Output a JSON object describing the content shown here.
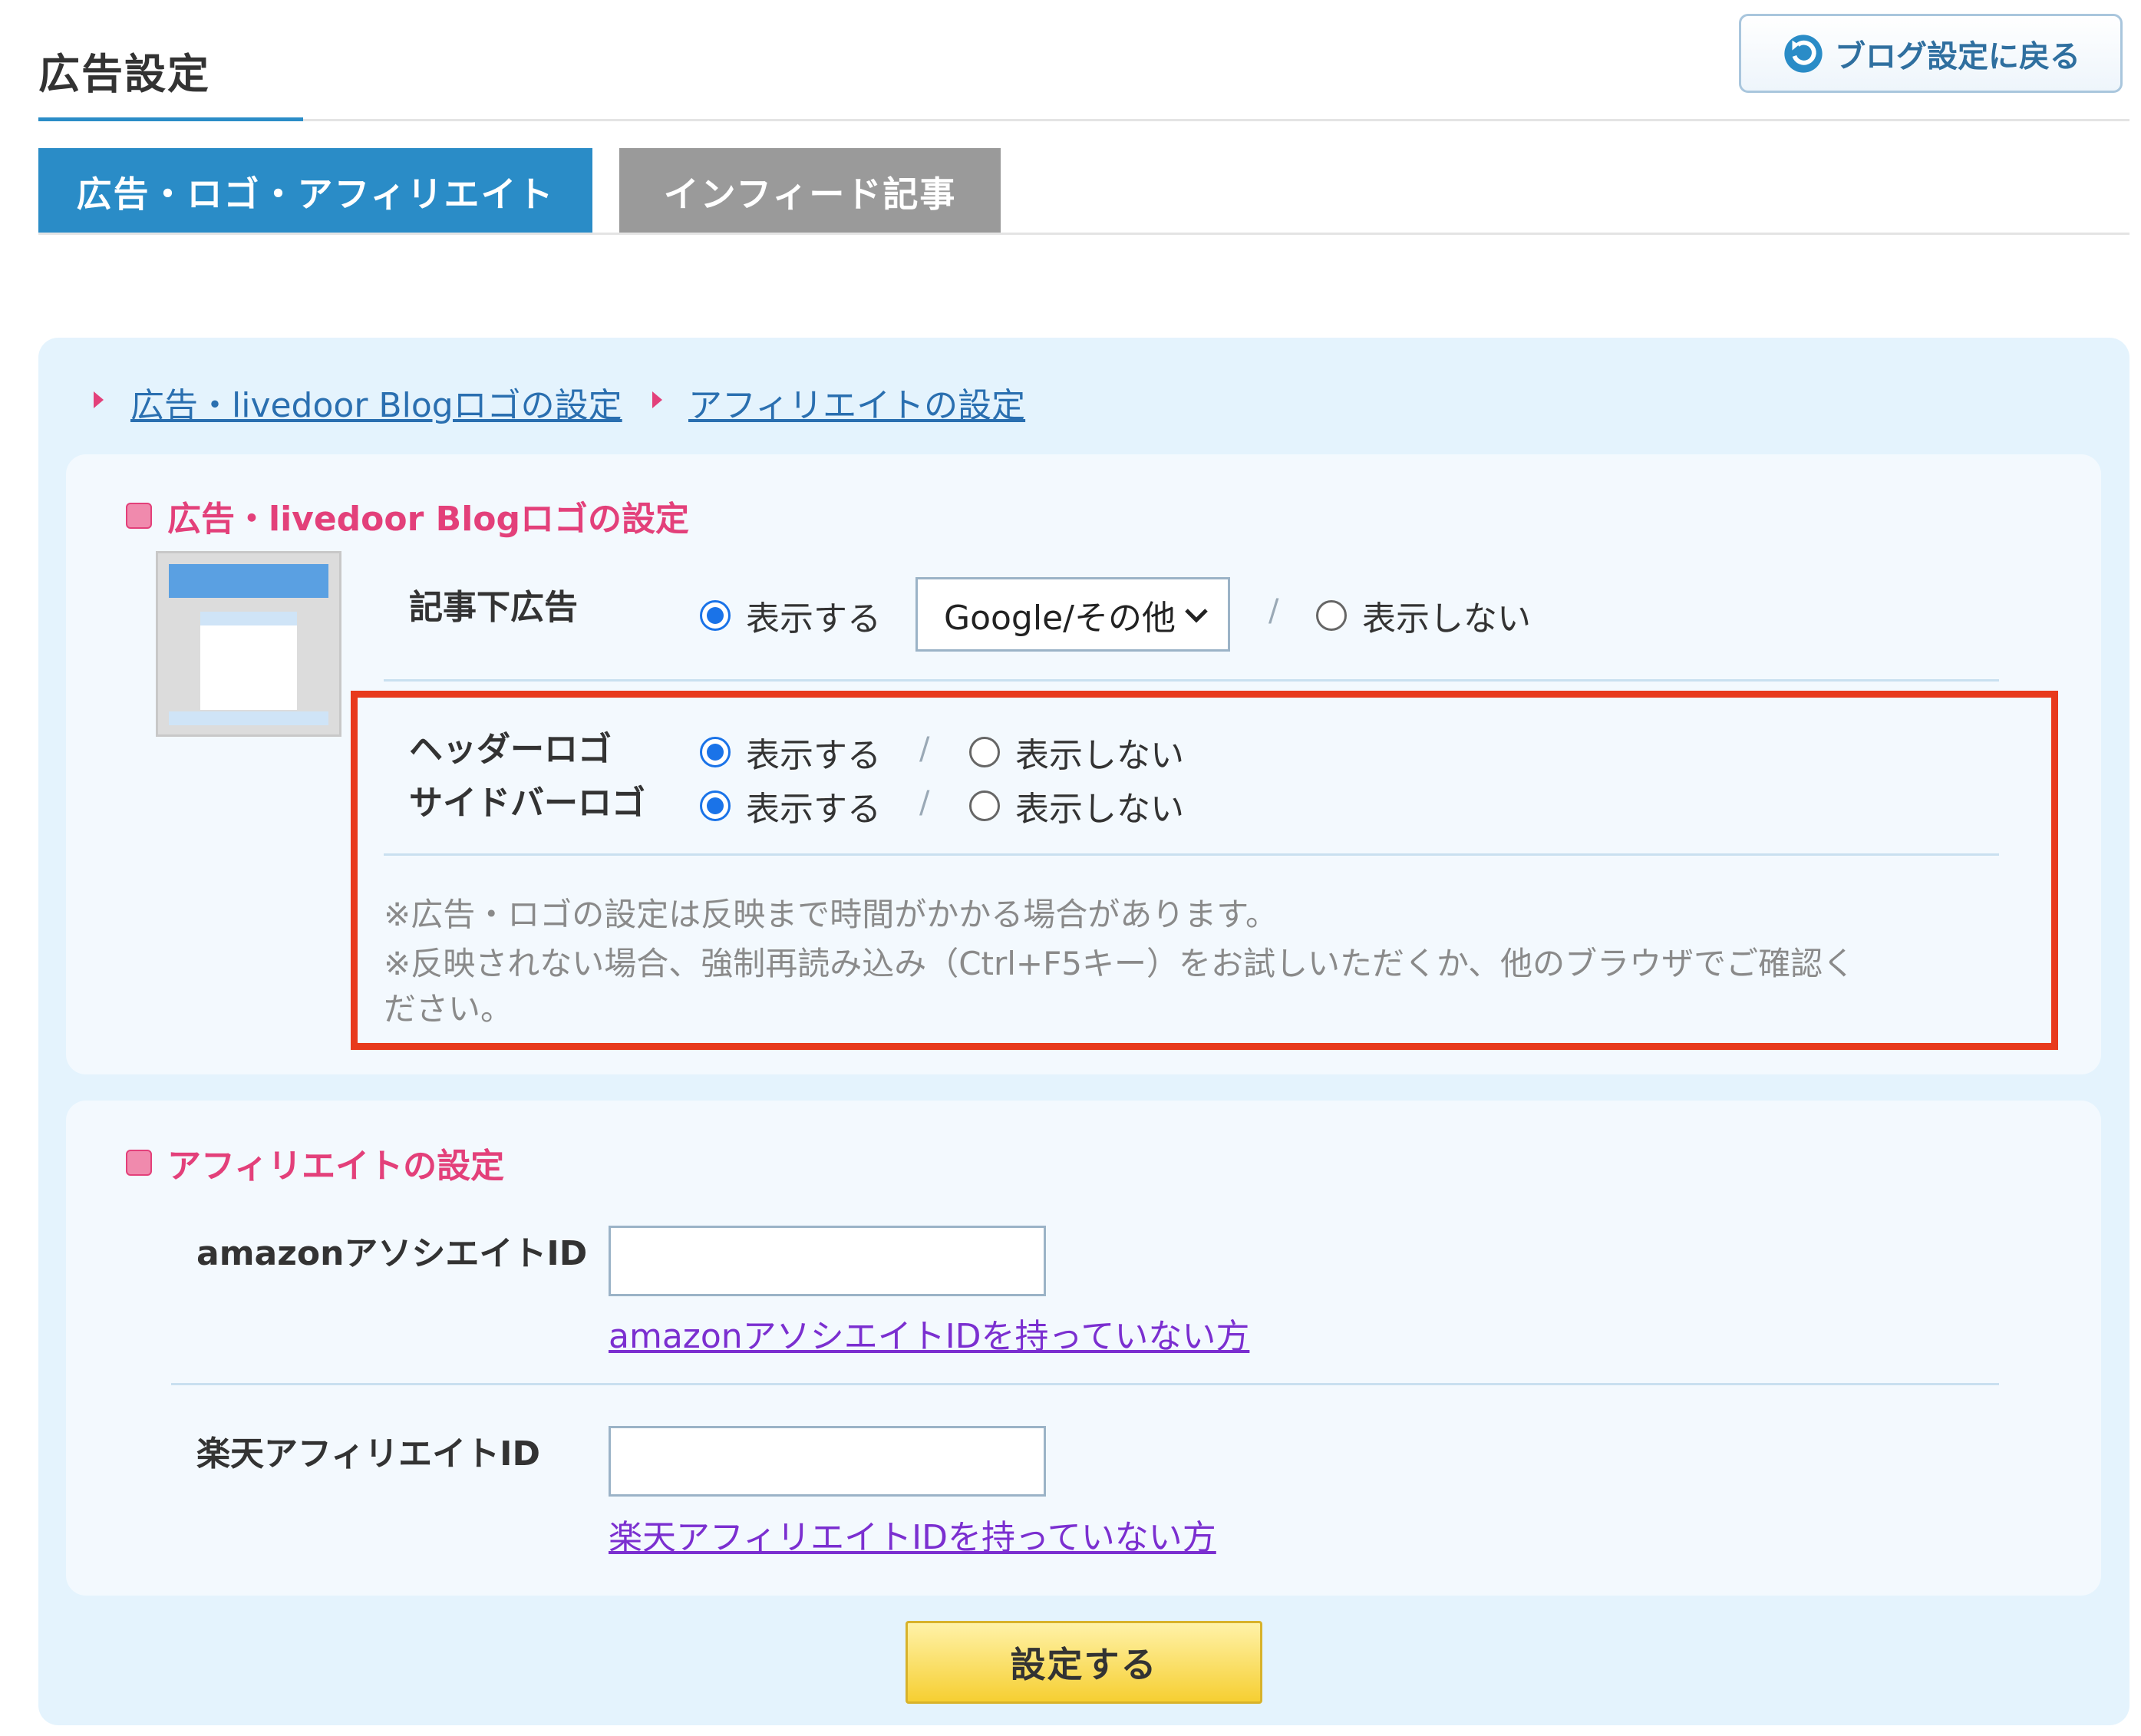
{
  "header": {
    "title": "広告設定",
    "back_button": "ブログ設定に戻る"
  },
  "tabs": [
    {
      "label": "広告・ロゴ・アフィリエイト",
      "active": true
    },
    {
      "label": "インフィード記事",
      "active": false
    }
  ],
  "anchors": [
    {
      "label": "広告・livedoor Blogロゴの設定"
    },
    {
      "label": "アフィリエイトの設定"
    }
  ],
  "ad_section": {
    "heading": "広告・livedoor Blogロゴの設定",
    "article_ad": {
      "label": "記事下広告",
      "show": "表示する",
      "hide": "表示しない",
      "selected": "show",
      "provider": "Google/その他"
    },
    "header_logo": {
      "label": "ヘッダーロゴ",
      "show": "表示する",
      "hide": "表示しない",
      "selected": "show"
    },
    "sidebar_logo": {
      "label": "サイドバーロゴ",
      "show": "表示する",
      "hide": "表示しない",
      "selected": "show"
    },
    "separator": "/",
    "notes": [
      "※広告・ロゴの設定は反映まで時間がかかる場合があります。",
      "※反映されない場合、強制再読み込み（Ctrl+F5キー）をお試しいただくか、他のブラウザでご確認く",
      "ださい。"
    ]
  },
  "affiliate_section": {
    "heading": "アフィリエイトの設定",
    "amazon": {
      "label": "amazonアソシエイトID",
      "value": "",
      "link": "amazonアソシエイトIDを持っていない方"
    },
    "rakuten": {
      "label": "楽天アフィリエイトID",
      "value": "",
      "link": "楽天アフィリエイトIDを持っていない方"
    }
  },
  "submit_label": "設定する",
  "colors": {
    "accent_blue": "#2a8cc7",
    "pink": "#e3407a",
    "highlight_red": "#e83a1c",
    "panel_bg": "#e4f3fd",
    "submit_yellow": "#f6cf32"
  }
}
